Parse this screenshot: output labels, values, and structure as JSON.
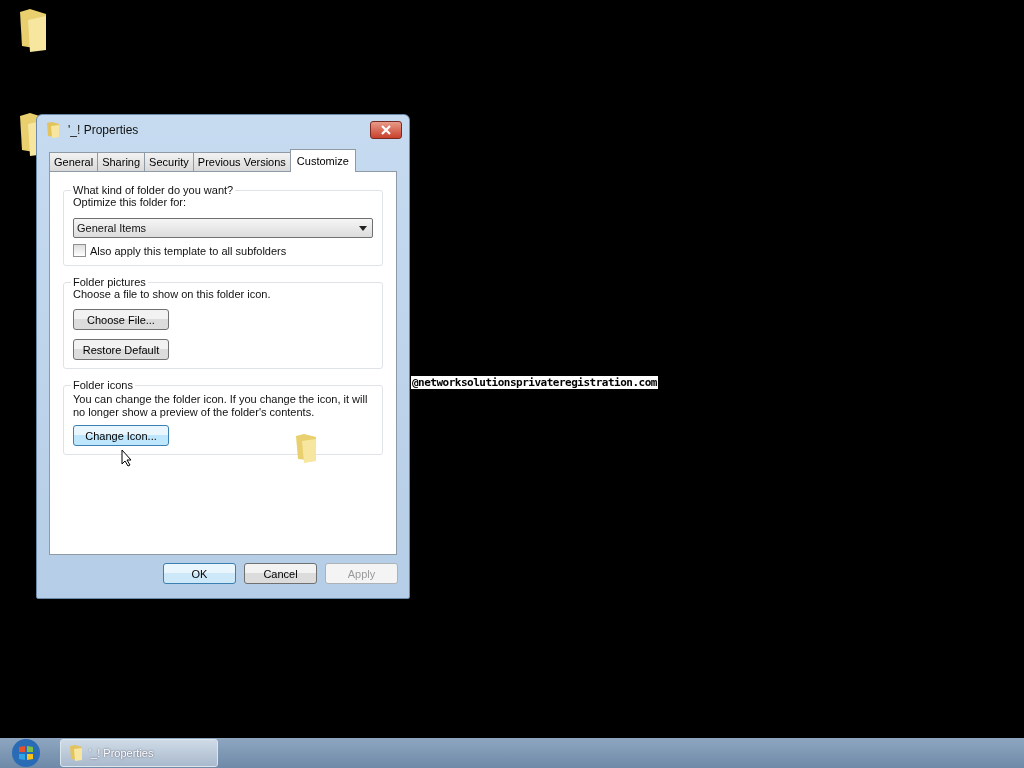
{
  "overlay_text": "@networksolutionsprivateregistration.com",
  "dialog": {
    "title": "'_! Properties",
    "tabs": [
      {
        "label": "General",
        "selected": false
      },
      {
        "label": "Sharing",
        "selected": false
      },
      {
        "label": "Security",
        "selected": false
      },
      {
        "label": "Previous Versions",
        "selected": false
      },
      {
        "label": "Customize",
        "selected": true
      }
    ],
    "folder_type": {
      "legend": "What kind of folder do you want?",
      "label": "Optimize this folder for:",
      "value": "General Items",
      "subfolders_checkbox": {
        "label": "Also apply this template to all subfolders",
        "checked": false
      }
    },
    "folder_pictures": {
      "legend": "Folder pictures",
      "text": "Choose a file to show on this folder icon.",
      "buttons": [
        "Choose File...",
        "Restore Default"
      ]
    },
    "folder_icons": {
      "legend": "Folder icons",
      "text": "You can change the folder icon. If you change the icon, it will no longer show a preview of the folder's contents.",
      "button": "Change Icon..."
    },
    "buttons": [
      {
        "label": "OK",
        "disabled": false,
        "default": true
      },
      {
        "label": "Cancel",
        "disabled": false,
        "default": false
      },
      {
        "label": "Apply",
        "disabled": true,
        "default": false
      }
    ]
  },
  "taskbar": {
    "items": [
      {
        "label": "'_! Properties"
      }
    ]
  }
}
